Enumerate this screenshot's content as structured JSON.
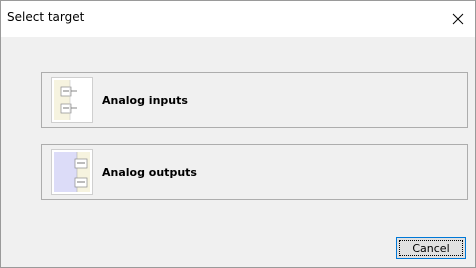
{
  "dialog": {
    "title": "Select target",
    "close_icon": "close-icon",
    "targets": [
      {
        "label": "Analog inputs",
        "icon": "analog-inputs-icon"
      },
      {
        "label": "Analog outputs",
        "icon": "analog-outputs-icon"
      }
    ],
    "cancel_label": "Cancel"
  },
  "colors": {
    "title_bar": "#ffffff",
    "client_area": "#f0f0f0",
    "button_border": "#adadad",
    "focus_border": "#0078d7",
    "icon_accent": "#dcdcf8"
  }
}
